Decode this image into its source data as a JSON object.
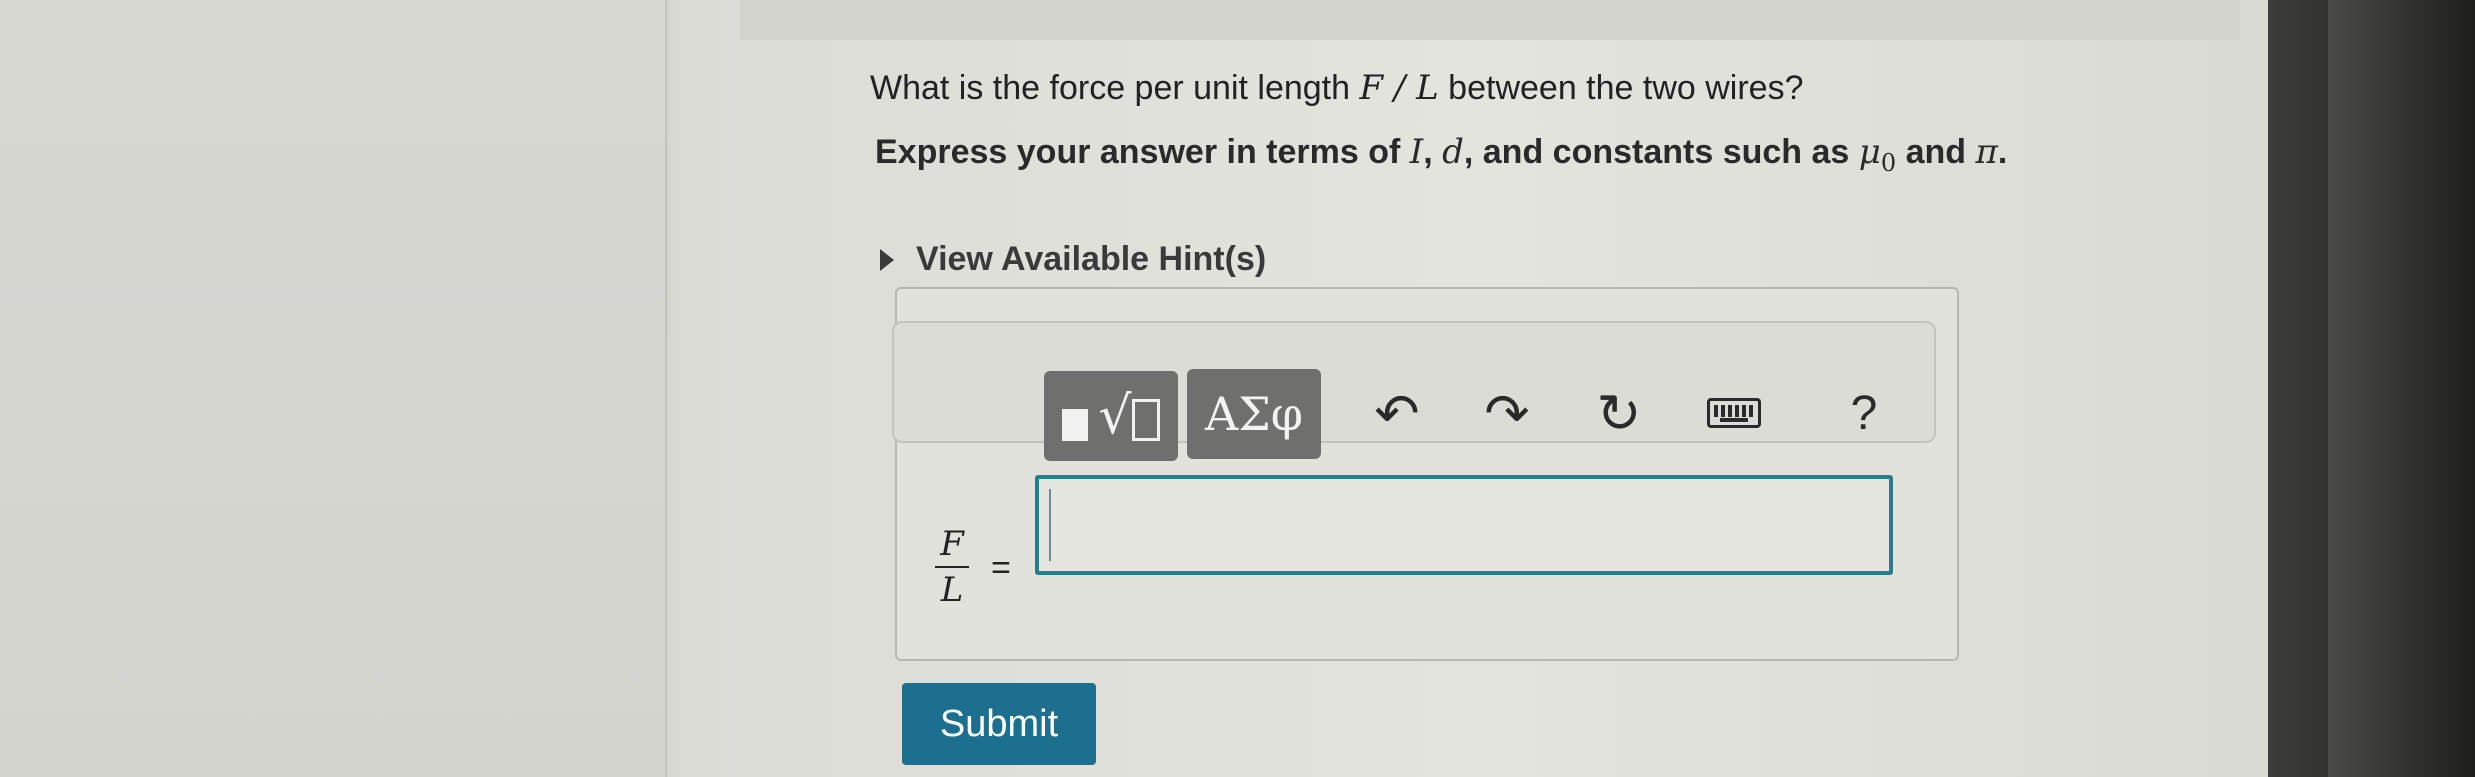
{
  "question": {
    "prefix": "What is the force per unit length ",
    "math": "F / L",
    "suffix": " between the two wires?"
  },
  "instruction": {
    "prefix": "Express your answer in terms of ",
    "var_i": "I",
    "sep1": ", ",
    "var_d": "d",
    "middle": ", and constants such as ",
    "mu": "μ",
    "mu_sub": "0",
    "and": " and ",
    "pi": "π",
    "end": "."
  },
  "hint": {
    "label": "View Available Hint(s)"
  },
  "toolbar": {
    "greek_label": "ΑΣφ",
    "help_label": "?",
    "undo_glyph": "↶",
    "redo_glyph": "↷",
    "reset_glyph": "↻",
    "radical_glyph": "√"
  },
  "answer": {
    "lhs_numerator": "F",
    "lhs_denominator": "L",
    "equals": "=",
    "value": ""
  },
  "submit": {
    "label": "Submit"
  },
  "colors": {
    "submit_bg": "#1c6f8e",
    "input_border": "#2b7d8c",
    "toolbar_button_bg": "#6f706e"
  }
}
